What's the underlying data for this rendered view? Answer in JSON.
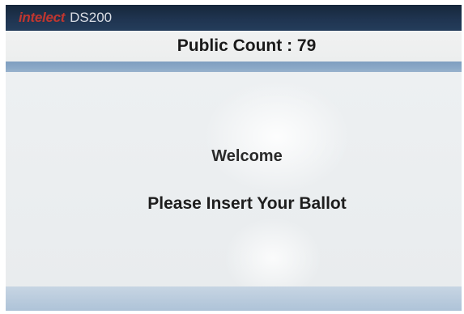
{
  "header": {
    "brand_logo": "intelect",
    "model": "DS200"
  },
  "status": {
    "count_label": "Public Count",
    "count_separator": " : ",
    "count_value": "79"
  },
  "main": {
    "welcome": "Welcome",
    "instruction": "Please Insert Your Ballot"
  },
  "colors": {
    "titlebar": "#1f3450",
    "accent_bar": "#8aa8c7",
    "logo_red": "#c0362f",
    "background": "#e9edf0"
  }
}
